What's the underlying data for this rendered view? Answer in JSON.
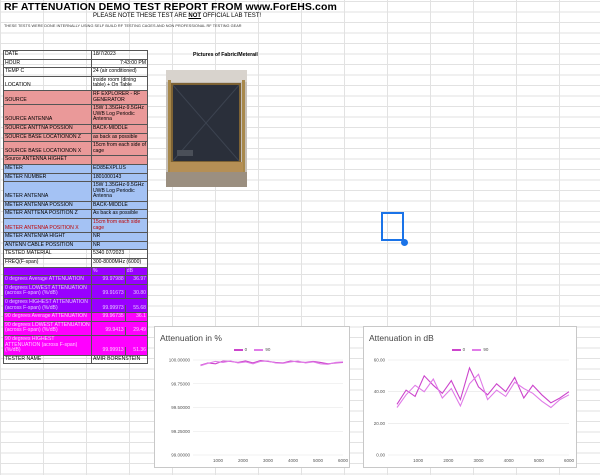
{
  "header": {
    "title": "RF ATTENUATION DEMO TEST REPORT FROM www.ForEHS.com",
    "notice_pre": "PLEASE NOTE THESE TEST ARE ",
    "notice_not": "NOT",
    "notice_post": " OFFICIAL LAB TEST!",
    "disclaimer": "THESE TESTS WERE DONE INTERNALLY USING SELF BUILD RF TESTING CAGES AND NON PROFESSIONAL RF TESTING GEAR"
  },
  "info_rows": [
    {
      "label": "DATE",
      "value": "18/7/2023",
      "style": ""
    },
    {
      "label": "HOUR",
      "value": "7:43:00 PM",
      "style": "",
      "align": "right"
    },
    {
      "label": "TEMP C",
      "value": "24 (air conditioned)",
      "style": ""
    },
    {
      "label": "LOCATION",
      "value": "inside room (dining table) + On Table",
      "style": ""
    },
    {
      "label": "SOURCE",
      "value": "RF EXPLORER - RF GENERATOR",
      "style": "src"
    },
    {
      "label": "SOURCE ANTENNA",
      "value": "15W 1.35GHz-9.5GHz UWB Log Periodic Antenna",
      "style": "src"
    },
    {
      "label": "SOURCE ANTTNA POSSION",
      "value": "BACK-MIDDLE",
      "style": "src"
    },
    {
      "label": "SOURCE BASE LOCATIONON Z",
      "value": "as back as possible",
      "style": "src"
    },
    {
      "label": "SOURCE BASE LOCATIONON X",
      "value": "15cm from each side of cage",
      "style": "src"
    },
    {
      "label": "Source ANTENNA HIGHET",
      "value": "",
      "style": "src"
    },
    {
      "label": "METER",
      "value": "ED85EXPLUS",
      "style": "met"
    },
    {
      "label": "METER NUMBER",
      "value": "1801000143",
      "style": "met"
    },
    {
      "label": "METER ANTENNA",
      "value": "15W 1.35GHz-9.5GHz UWB Log Periodic Antenna",
      "style": "met"
    },
    {
      "label": "METER ANTENNA POSSION",
      "value": "BACK-MIDDLE",
      "style": "met"
    },
    {
      "label": "METER ANTTENA POSITION Z",
      "value": "As back as possible",
      "style": "met"
    },
    {
      "label": "METER ANTENNA POSITION X",
      "value": "15cm from each side cage",
      "style": "met red"
    },
    {
      "label": "METER ANTENNA HIGHT",
      "value": "NR",
      "style": "met"
    },
    {
      "label": "ANTENN CABLE POSSITION",
      "value": "NR",
      "style": "met"
    },
    {
      "label": "TESTED MATERIAL",
      "value": "5340 07/2023",
      "style": ""
    },
    {
      "label": "FREQ(F-span)",
      "value": "300-8000MHz (6000)",
      "style": ""
    }
  ],
  "results_header": {
    "pct": "%",
    "db": "dB"
  },
  "results_rows": [
    {
      "label": "0 degrees Average ATTENUATION",
      "pct": "99.97988",
      "db": "36.97",
      "style": "pur"
    },
    {
      "label": "0 degrees   LOWEST ATTENUATION (across F-span) (%/dB)",
      "pct": "99.91673",
      "db": "30.80",
      "style": "pur"
    },
    {
      "label": "0 degrees   HIGHEST ATTENUATION (across F-span) (%/dB)",
      "pct": "99.99973",
      "db": "55.68",
      "style": "pur"
    },
    {
      "label": "90 degrees Average ATTENUATION",
      "pct": "99.96735",
      "db": "36.1",
      "style": "mag"
    },
    {
      "label": "90 degrees   LOWEST ATTENUATION (across F-span) (%/dB)",
      "pct": "99.9413",
      "db": "29.49",
      "style": "mag"
    },
    {
      "label": "90 degrees   HIGHEST ATTENUATION (across F-span) (%/dB)",
      "pct": "99.99913",
      "db": "51.36",
      "style": "mag"
    }
  ],
  "tester": {
    "label": "TESTER NAME",
    "value": "AMIR BORENSTEIN"
  },
  "pictures_title": "Pictures of Fabric/Meterail",
  "colors": {
    "series_0": "#cc44cc",
    "series_90": "#e07ce8",
    "source": "#ea9999",
    "meter": "#a4c2f4",
    "purple": "#9900ff",
    "magenta": "#ff00ff"
  },
  "chart_data": [
    {
      "type": "line",
      "title": "Attenuation in %",
      "series": [
        {
          "name": "0",
          "x": [
            300,
            600,
            900,
            1200,
            1500,
            1800,
            2100,
            2400,
            2700,
            3000,
            3300,
            3600,
            3900,
            4200,
            4500,
            4800,
            5100,
            5400,
            5700,
            6000
          ],
          "values": [
            99.945,
            99.97,
            99.96,
            99.99,
            99.985,
            99.975,
            99.99,
            99.97,
            99.995,
            99.985,
            99.975,
            99.97,
            99.99,
            99.98,
            99.975,
            99.985,
            99.975,
            99.96,
            99.97,
            99.975
          ]
        },
        {
          "name": "90",
          "x": [
            300,
            600,
            900,
            1200,
            1500,
            1800,
            2100,
            2400,
            2700,
            3000,
            3300,
            3600,
            3900,
            4200,
            4500,
            4800,
            5100,
            5400,
            5700,
            6000
          ],
          "values": [
            99.94,
            99.965,
            99.985,
            99.975,
            99.99,
            99.97,
            99.98,
            99.96,
            99.985,
            99.99,
            99.97,
            99.965,
            99.98,
            99.99,
            99.97,
            99.98,
            99.96,
            99.955,
            99.975,
            99.98
          ]
        }
      ],
      "xticks": [
        "1000",
        "2000",
        "3000",
        "4000",
        "5000",
        "6000"
      ],
      "yticks": [
        "100.00000",
        "99.75000",
        "99.50000",
        "99.25000",
        "99.00000"
      ],
      "ylim": [
        99.0,
        100.0
      ],
      "xlim": [
        0,
        6000
      ],
      "legend": "top-center"
    },
    {
      "type": "line",
      "title": "Attenuation in dB",
      "series": [
        {
          "name": "0",
          "x": [
            300,
            600,
            900,
            1200,
            1500,
            1800,
            2100,
            2400,
            2700,
            3000,
            3300,
            3600,
            3900,
            4200,
            4500,
            4800,
            5100,
            5400,
            5700,
            6000
          ],
          "values": [
            32,
            41,
            37,
            50,
            44,
            39,
            47,
            35,
            55,
            43,
            38,
            45,
            40,
            49,
            36,
            44,
            38,
            33,
            36,
            40
          ]
        },
        {
          "name": "90",
          "x": [
            300,
            600,
            900,
            1200,
            1500,
            1800,
            2100,
            2400,
            2700,
            3000,
            3300,
            3600,
            3900,
            4200,
            4500,
            4800,
            5100,
            5400,
            5700,
            6000
          ],
          "values": [
            30,
            38,
            44,
            40,
            48,
            36,
            42,
            31,
            45,
            51,
            35,
            41,
            37,
            46,
            42,
            39,
            34,
            30,
            35,
            38
          ]
        }
      ],
      "xticks": [
        "1000",
        "2000",
        "3000",
        "4000",
        "5000",
        "6000"
      ],
      "yticks": [
        "60.00",
        "40.00",
        "20.00",
        "0.00"
      ],
      "ylim": [
        0,
        60
      ],
      "xlim": [
        0,
        6000
      ],
      "legend": "top-center"
    }
  ]
}
